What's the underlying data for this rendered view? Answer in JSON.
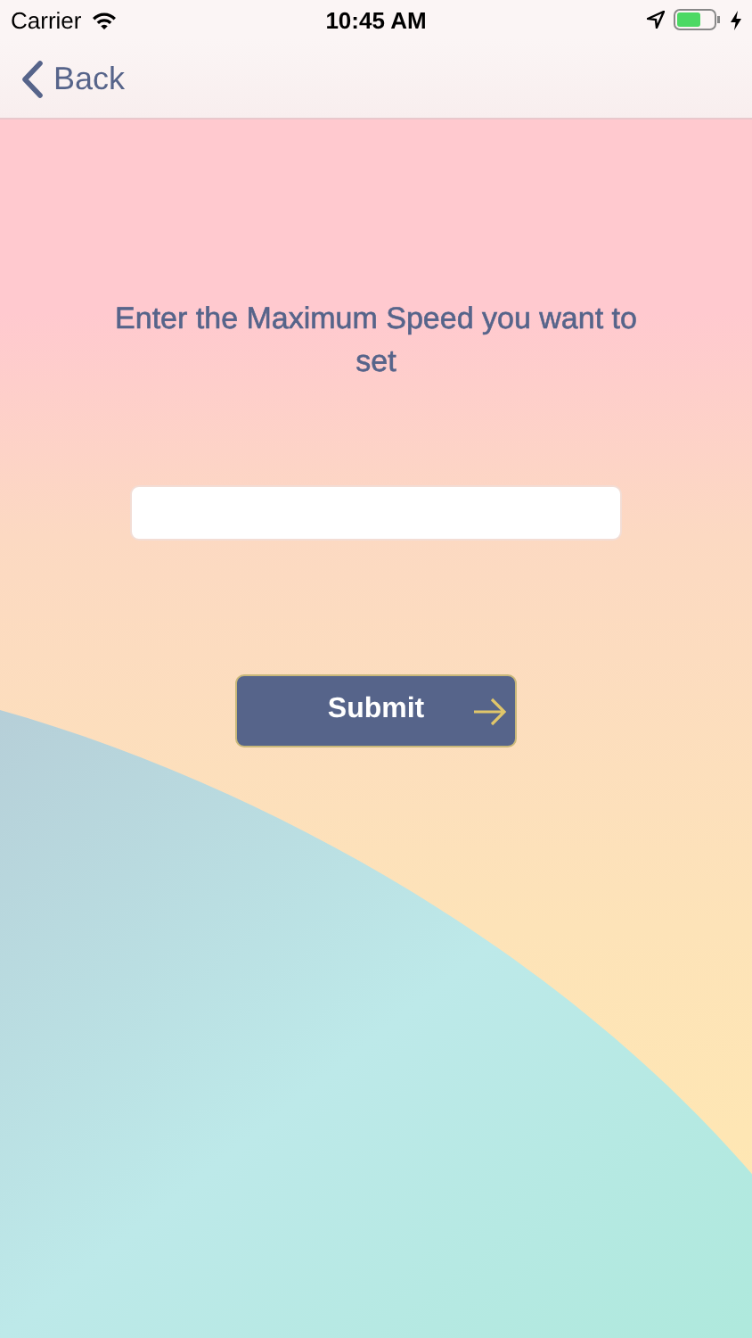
{
  "status_bar": {
    "carrier": "Carrier",
    "time": "10:45 AM"
  },
  "nav_bar": {
    "back_label": "Back"
  },
  "prompt": "Enter the Maximum Speed you want to set",
  "submit_button": {
    "label": "Submit"
  }
}
